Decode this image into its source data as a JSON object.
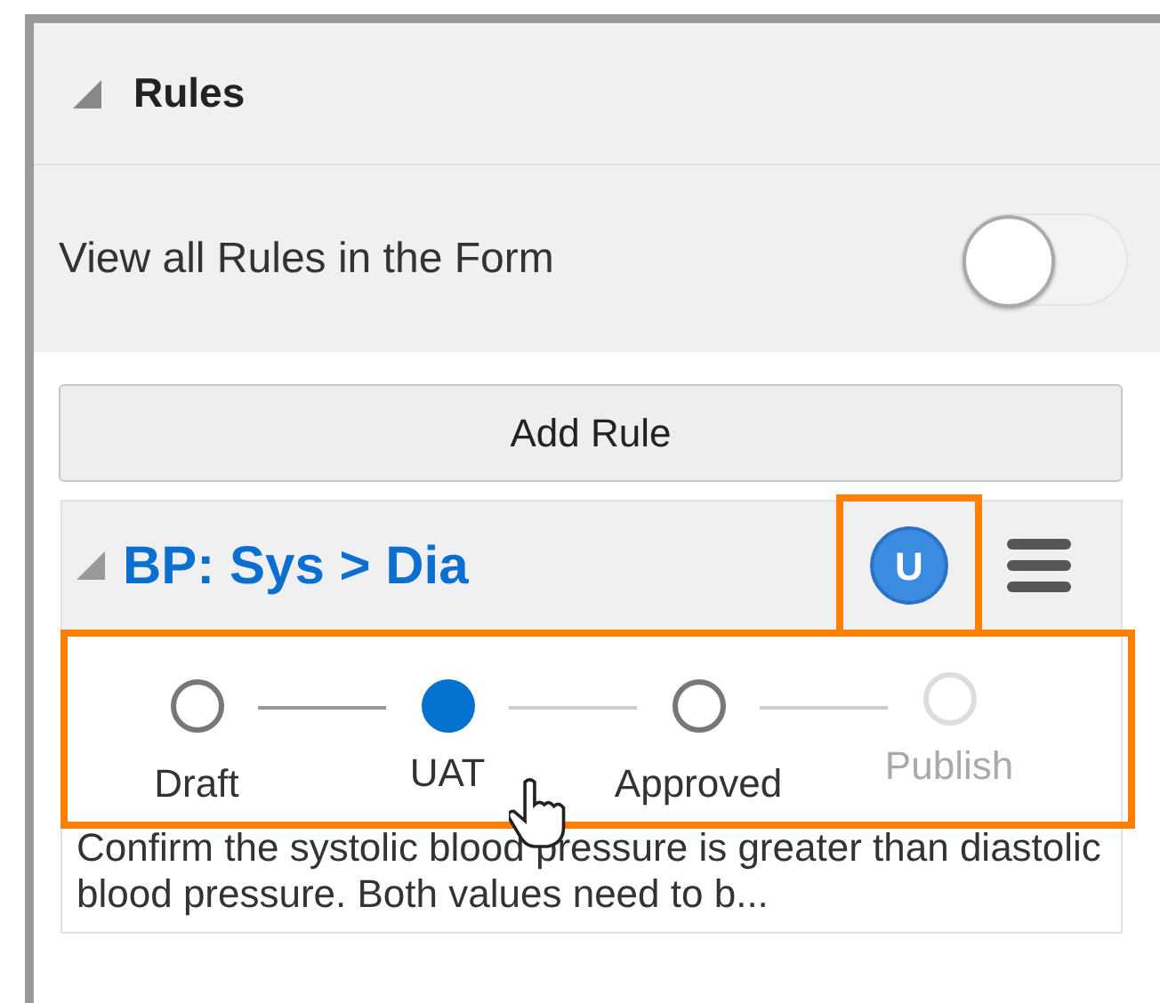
{
  "panel": {
    "title": "Rules",
    "expanded": true
  },
  "view_all_toggle": {
    "label": "View all Rules in the Form",
    "on": false
  },
  "add_button": "Add Rule",
  "rule": {
    "title": "BP: Sys > Dia",
    "expanded": true,
    "status_badge": {
      "text": "U",
      "highlighted": true
    },
    "stepper": {
      "highlighted": true,
      "steps": [
        {
          "label": "Draft",
          "selected": false,
          "disabled": false
        },
        {
          "label": "UAT",
          "selected": true,
          "disabled": false
        },
        {
          "label": "Approved",
          "selected": false,
          "disabled": false
        },
        {
          "label": "Publish",
          "selected": false,
          "disabled": true
        }
      ]
    },
    "description": "Confirm the systolic blood pressure is greater than diastolic blood pressure. Both values need to b..."
  }
}
